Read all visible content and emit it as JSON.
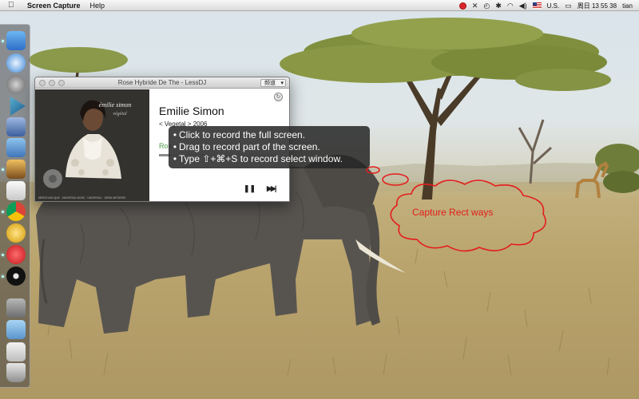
{
  "menubar": {
    "apple_glyph": "",
    "app_name": "Screen Capture",
    "help_label": "Help",
    "status": {
      "input_source": "U.S.",
      "clock": "周日 13 55 38",
      "user": "tian"
    }
  },
  "window": {
    "title": "Rose Hybride De The - LessDJ",
    "channel": "频道",
    "artist": "Emilie Simon",
    "album": "< Vegetal > 2006",
    "song_partial": "Ros",
    "progress": 0.09,
    "pause_glyph": "❚❚",
    "next_glyph": "▶▶|",
    "refresh_glyph": "↻",
    "cover": {
      "artist_script": "émilie simon",
      "album_script": "végétal",
      "footer": "MERCIOUSLIQUE · UNIVERSAL MUSIC · UNIVERSAL · JAPAN NETWORK"
    }
  },
  "tooltip": {
    "lines": [
      "Click to record the full screen.",
      "Drag to record part of the screen.",
      "Type ⇧+⌘+S to record select window."
    ],
    "bullet": "•"
  },
  "annotation": {
    "text": "Capture Rect  ways",
    "color": "#e41d1d"
  },
  "dock": {
    "apps": [
      "finder",
      "safari",
      "launchpad",
      "xcode",
      "preview",
      "instruments",
      "iphoto",
      "textedit",
      "chrome",
      "instruments-a",
      "screen-capture",
      "dvd-player",
      "stack",
      "folder",
      "downloads",
      "trash"
    ]
  }
}
